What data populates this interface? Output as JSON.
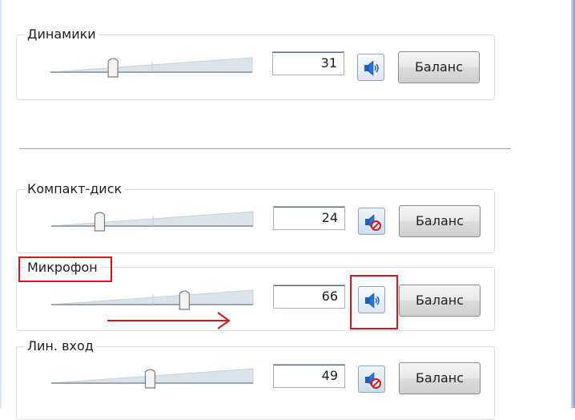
{
  "channels": [
    {
      "key": "speakers",
      "label": "Динамики",
      "value": "31",
      "level": 31,
      "muted": false,
      "balance_label": "Баланс"
    },
    {
      "key": "cd",
      "label": "Компакт-диск",
      "value": "24",
      "level": 24,
      "muted": true,
      "balance_label": "Баланс"
    },
    {
      "key": "mic",
      "label": "Микрофон",
      "value": "66",
      "level": 66,
      "muted": false,
      "balance_label": "Баланс"
    },
    {
      "key": "line_in",
      "label": "Лин. вход",
      "value": "49",
      "level": 49,
      "muted": true,
      "balance_label": "Баланс"
    }
  ],
  "annotation": {
    "color": "#d8151b",
    "highlighted": [
      "mic-label",
      "mic-mute-button"
    ],
    "arrow": "right"
  },
  "icons": {
    "volume": "speaker-icon",
    "muted": "speaker-muted-icon"
  }
}
